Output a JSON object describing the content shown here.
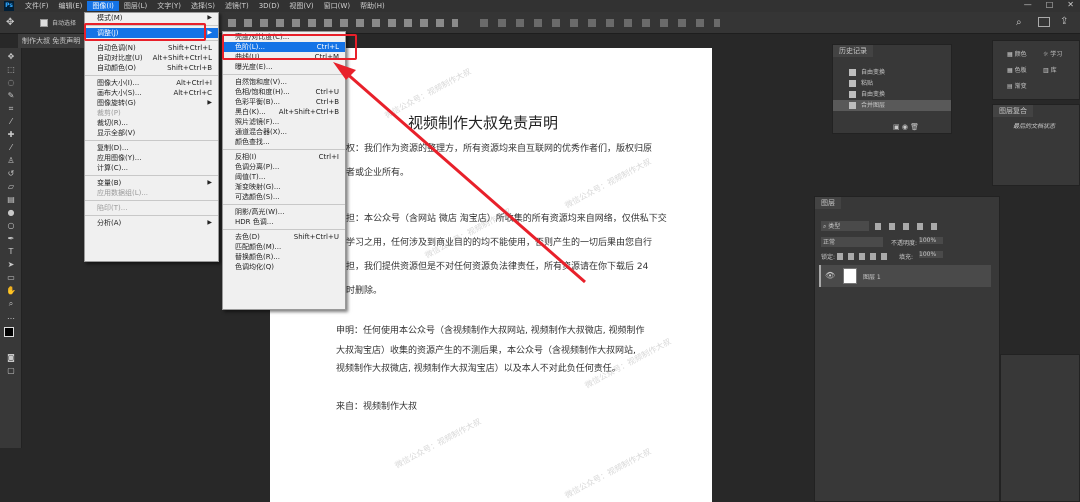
{
  "menubar": {
    "logo": "Ps",
    "items": [
      "文件(F)",
      "编辑(E)",
      "图像(I)",
      "图层(L)",
      "文字(Y)",
      "选择(S)",
      "滤镜(T)",
      "3D(D)",
      "视图(V)",
      "窗口(W)",
      "帮助(H)"
    ],
    "active_index": 2
  },
  "window_controls": [
    "—",
    "□",
    "✕"
  ],
  "options_bar": {
    "auto_select": "自动选择"
  },
  "doc_tab": "制作大叔 免责声明",
  "image_menu": {
    "items": [
      {
        "label": "模式(M)",
        "shortcut": "",
        "submenu": true,
        "state": "normal"
      },
      {
        "sep": true
      },
      {
        "label": "调整(J)",
        "shortcut": "",
        "submenu": true,
        "state": "highlight"
      },
      {
        "sep": true
      },
      {
        "label": "自动色调(N)",
        "shortcut": "Shift+Ctrl+L",
        "state": "normal"
      },
      {
        "label": "自动对比度(U)",
        "shortcut": "Alt+Shift+Ctrl+L",
        "state": "normal"
      },
      {
        "label": "自动颜色(O)",
        "shortcut": "Shift+Ctrl+B",
        "state": "normal"
      },
      {
        "sep": true
      },
      {
        "label": "图像大小(I)...",
        "shortcut": "Alt+Ctrl+I",
        "state": "normal"
      },
      {
        "label": "画布大小(S)...",
        "shortcut": "Alt+Ctrl+C",
        "state": "normal"
      },
      {
        "label": "图像旋转(G)",
        "shortcut": "",
        "submenu": true,
        "state": "normal"
      },
      {
        "label": "裁剪(P)",
        "shortcut": "",
        "state": "disabled"
      },
      {
        "label": "裁切(R)...",
        "shortcut": "",
        "state": "normal"
      },
      {
        "label": "显示全部(V)",
        "shortcut": "",
        "state": "normal"
      },
      {
        "sep": true
      },
      {
        "label": "复制(D)...",
        "shortcut": "",
        "state": "normal"
      },
      {
        "label": "应用图像(Y)...",
        "shortcut": "",
        "state": "normal"
      },
      {
        "label": "计算(C)...",
        "shortcut": "",
        "state": "normal"
      },
      {
        "sep": true
      },
      {
        "label": "变量(B)",
        "shortcut": "",
        "submenu": true,
        "state": "normal"
      },
      {
        "label": "应用数据组(L)...",
        "shortcut": "",
        "state": "disabled"
      },
      {
        "sep": true
      },
      {
        "label": "陷印(T)...",
        "shortcut": "",
        "state": "disabled"
      },
      {
        "sep": true
      },
      {
        "label": "分析(A)",
        "shortcut": "",
        "submenu": true,
        "state": "normal"
      }
    ]
  },
  "adjust_menu": {
    "items": [
      {
        "label": "亮度/对比度(C)...",
        "shortcut": "",
        "state": "normal"
      },
      {
        "label": "色阶(L)...",
        "shortcut": "Ctrl+L",
        "state": "highlight"
      },
      {
        "label": "曲线(U)...",
        "shortcut": "Ctrl+M",
        "state": "normal"
      },
      {
        "label": "曝光度(E)...",
        "shortcut": "",
        "state": "normal"
      },
      {
        "sep": true
      },
      {
        "label": "自然饱和度(V)...",
        "shortcut": "",
        "state": "normal"
      },
      {
        "label": "色相/饱和度(H)...",
        "shortcut": "Ctrl+U",
        "state": "normal"
      },
      {
        "label": "色彩平衡(B)...",
        "shortcut": "Ctrl+B",
        "state": "normal"
      },
      {
        "label": "黑白(K)...",
        "shortcut": "Alt+Shift+Ctrl+B",
        "state": "normal"
      },
      {
        "label": "照片滤镜(F)...",
        "shortcut": "",
        "state": "normal"
      },
      {
        "label": "通道混合器(X)...",
        "shortcut": "",
        "state": "normal"
      },
      {
        "label": "颜色查找...",
        "shortcut": "",
        "state": "normal"
      },
      {
        "sep": true
      },
      {
        "label": "反相(I)",
        "shortcut": "Ctrl+I",
        "state": "normal"
      },
      {
        "label": "色调分离(P)...",
        "shortcut": "",
        "state": "normal"
      },
      {
        "label": "阈值(T)...",
        "shortcut": "",
        "state": "normal"
      },
      {
        "label": "渐变映射(G)...",
        "shortcut": "",
        "state": "normal"
      },
      {
        "label": "可选颜色(S)...",
        "shortcut": "",
        "state": "normal"
      },
      {
        "sep": true
      },
      {
        "label": "阴影/高光(W)...",
        "shortcut": "",
        "state": "normal"
      },
      {
        "label": "HDR 色调...",
        "shortcut": "",
        "state": "normal"
      },
      {
        "sep": true
      },
      {
        "label": "去色(D)",
        "shortcut": "Shift+Ctrl+U",
        "state": "normal"
      },
      {
        "label": "匹配颜色(M)...",
        "shortcut": "",
        "state": "normal"
      },
      {
        "label": "替换颜色(R)...",
        "shortcut": "",
        "state": "normal"
      },
      {
        "label": "色调均化(Q)",
        "shortcut": "",
        "state": "normal"
      }
    ]
  },
  "document": {
    "title": "视频制作大叔免责声明",
    "p1a": "权：我们作为资源的整理方，所有资源均来自互联网的优秀作者们，版权归原",
    "p1b": "者或企业所有。",
    "p2a": "担：本公众号（含网站 微店 淘宝店）所收集的所有资源均来自网络，仅供私下交",
    "p2b": "学习之用，任何涉及到商业目的的均不能使用，否则产生的一切后果由您自行",
    "p2c": "担，我们提供资源但是不对任何资源负法律责任，所有资源请在你下载后 24",
    "p2d": "时删除。",
    "p3a": "申明：任何使用本公众号（含视频制作大叔网站, 视频制作大叔微店, 视频制作",
    "p3b": "大叔淘宝店）收集的资源产生的不测后果，本公众号（含视频制作大叔网站,",
    "p3c": "视频制作大叔微店, 视频制作大叔淘宝店）以及本人不对此负任何责任。",
    "p4": "来自：视频制作大叔",
    "watermarks": [
      "微信公众号：视频制作大叔",
      "微信公众号：视频制作大叔",
      "微信公众号：视频制作大叔",
      "微信公众号：视频制作大叔",
      "微信公众号：视频制作大叔",
      "微信公众号：视频制作大叔"
    ]
  },
  "history_panel": {
    "tab": "历史记录",
    "items": [
      "自由变换",
      "粘贴",
      "自由变换",
      "合并图层"
    ],
    "selected": 3
  },
  "color_panel": {
    "items": [
      "颜色",
      "色板",
      "渐变"
    ],
    "items2": [
      "学习",
      "库"
    ]
  },
  "properties_panel": {
    "tab": "图层复合",
    "label": "最后的文档状态"
  },
  "layers_panel": {
    "tab": "图层",
    "kind": "类型",
    "blend": "正常",
    "opacity_label": "不透明度:",
    "opacity": "100%",
    "lock_label": "锁定:",
    "fill_label": "填充:",
    "fill": "100%",
    "layer_name": "图层 1"
  },
  "colors": {
    "accent": "#1473e6",
    "highlight_box": "#e8202a",
    "arrow": "#e8202a"
  }
}
